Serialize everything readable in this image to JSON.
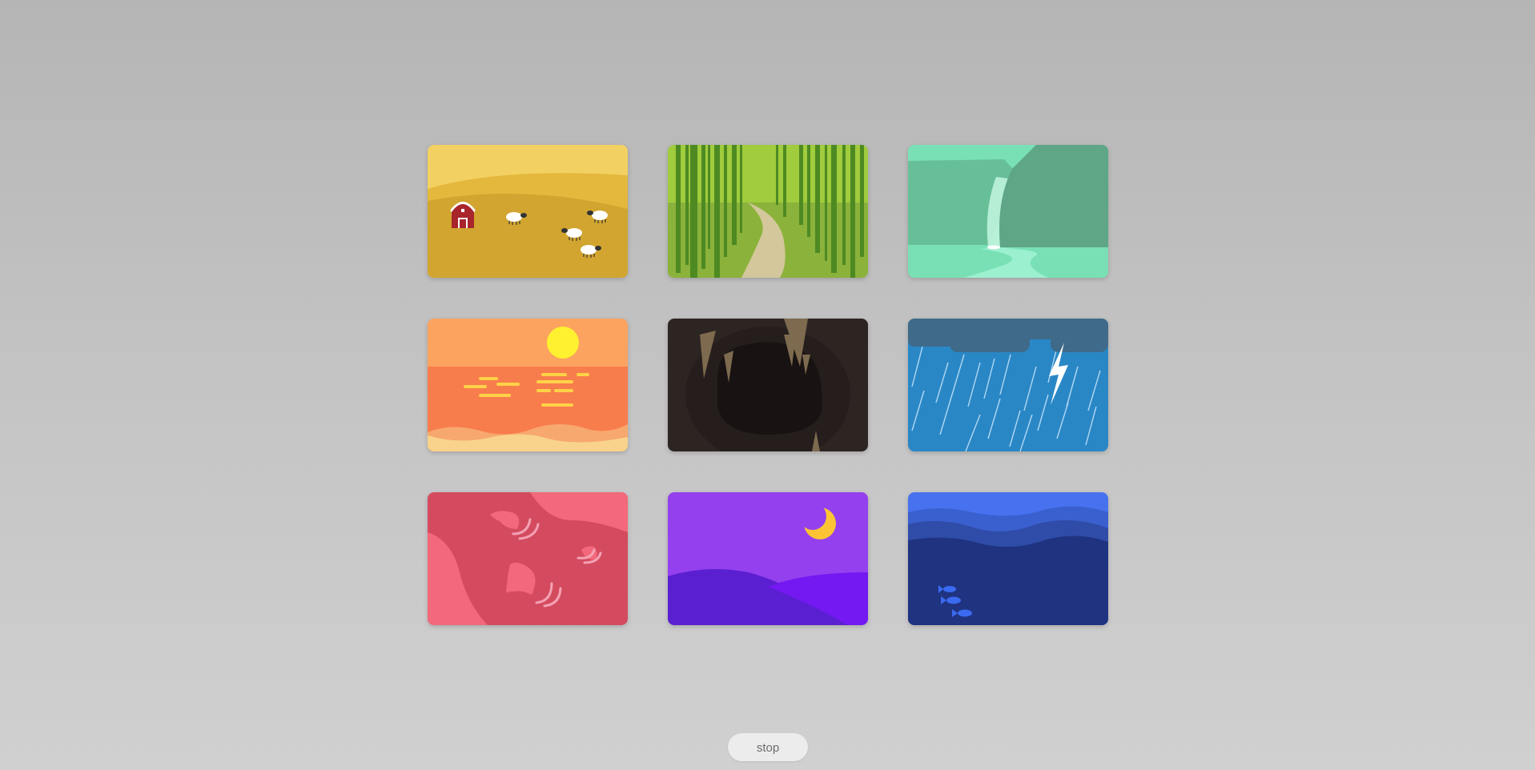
{
  "scenes": [
    {
      "name": "farm-scene",
      "colors": {
        "sky": "#f3d062",
        "field": "#d1a52f",
        "barn": "#a8252c"
      }
    },
    {
      "name": "forest-path-scene",
      "colors": {
        "sky": "#a0cc3d",
        "ground": "#8bb23a",
        "trees": "#4e8a22",
        "path": "#d3c79b"
      }
    },
    {
      "name": "waterfall-scene",
      "colors": {
        "sky": "#79e0b5",
        "cliff": "#5ea686",
        "water": "#9bf0cf"
      }
    },
    {
      "name": "sunset-beach-scene",
      "colors": {
        "sky": "#fba35f",
        "sea": "#f87d4c",
        "sun": "#fff12f",
        "sand": "#f9d38b"
      }
    },
    {
      "name": "cave-scene",
      "colors": {
        "wall": "#2d2522",
        "inner": "#181312",
        "stalactite": "#7d6a4f"
      }
    },
    {
      "name": "thunderstorm-scene",
      "colors": {
        "sky": "#2a87c6",
        "cloud": "#3f6a89",
        "bolt": "#ffffff"
      }
    },
    {
      "name": "windy-scene",
      "colors": {
        "bg": "#d44b60",
        "light": "#f3687b",
        "swirl": "#f4a2b3"
      }
    },
    {
      "name": "night-scene",
      "colors": {
        "sky": "#9440ef",
        "hill-left": "#5a1fd0",
        "hill-right": "#7419f1",
        "moon": "#fcc434"
      }
    },
    {
      "name": "underwater-scene",
      "colors": {
        "surface": "#4772ef",
        "deep": "#1f3380",
        "fish": "#3a6af0"
      }
    }
  ],
  "controls": {
    "stop_label": "stop"
  }
}
